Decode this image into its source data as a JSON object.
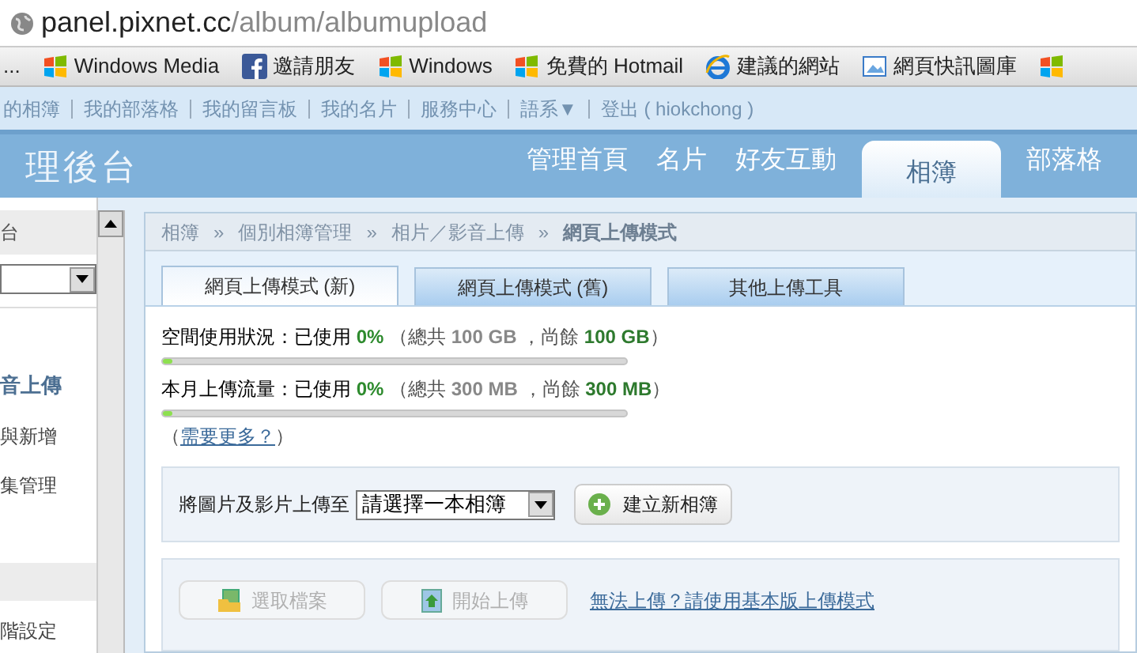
{
  "address_bar": {
    "host": "panel.pixnet.cc",
    "path": "/album/albumupload"
  },
  "bookmarks": [
    {
      "kind": "text",
      "label": "..."
    },
    {
      "kind": "windows",
      "label": "Windows Media"
    },
    {
      "kind": "facebook",
      "label": "邀請朋友"
    },
    {
      "kind": "windows",
      "label": "Windows"
    },
    {
      "kind": "windows",
      "label": "免費的 Hotmail"
    },
    {
      "kind": "ie",
      "label": "建議的網站"
    },
    {
      "kind": "gallery",
      "label": "網頁快訊圖庫"
    },
    {
      "kind": "windows"
    }
  ],
  "top_links": [
    "的相簿",
    "我的部落格",
    "我的留言板",
    "我的名片",
    "服務中心",
    "語系▼",
    "登出 ( hiokchong )"
  ],
  "header": {
    "title": "理後台",
    "nav": [
      {
        "label": "管理首頁",
        "selected": false
      },
      {
        "label": "名片",
        "selected": false
      },
      {
        "label": "好友互動",
        "selected": false
      },
      {
        "label": "相簿",
        "selected": true
      },
      {
        "label": "部落格",
        "selected": false
      }
    ]
  },
  "sidebar": {
    "heading": "台",
    "items": [
      {
        "label": "音上傳",
        "selected": true
      },
      {
        "label": "與新增",
        "selected": false
      },
      {
        "label": "集管理",
        "selected": false
      }
    ],
    "items_2": [
      {
        "label": "階設定",
        "selected": false
      }
    ]
  },
  "breadcrumb": {
    "items": [
      {
        "label": "相簿",
        "current": false
      },
      {
        "label": "個別相簿管理",
        "current": false
      },
      {
        "label": "相片／影音上傳",
        "current": false
      },
      {
        "label": "網頁上傳模式",
        "current": true
      }
    ],
    "separators": [
      "»",
      "»",
      "»"
    ]
  },
  "tabs": [
    {
      "label": "網頁上傳模式 (新)",
      "selected": true
    },
    {
      "label": "網頁上傳模式 (舊)",
      "selected": false
    },
    {
      "label": "其他上傳工具",
      "selected": false
    }
  ],
  "usage": [
    {
      "label": "空間使用狀況：已使用",
      "percent": "0%",
      "total_label": "（總共",
      "total": "100 GB",
      "remain_label": "，尚餘",
      "remain": "100 GB",
      "close": "）",
      "level": 0.02
    },
    {
      "label": "本月上傳流量：已使用",
      "percent": "0%",
      "total_label": "（總共",
      "total": "300 MB",
      "remain_label": "，尚餘",
      "remain": "300 MB",
      "close": "）",
      "level": 0.02
    }
  ],
  "more": {
    "open": "（",
    "link": "需要更多？",
    "close": "）"
  },
  "upload_to": {
    "label": "將圖片及影片上傳至",
    "album_select": "請選擇一本相簿",
    "create_button": "建立新相簿"
  },
  "actions": {
    "buttons": [
      {
        "label": "選取檔案",
        "kind": "folder",
        "disabled": true
      },
      {
        "label": "開始上傳",
        "kind": "upload",
        "disabled": true
      }
    ],
    "fallback_link": "無法上傳？請使用基本版上傳模式"
  }
}
